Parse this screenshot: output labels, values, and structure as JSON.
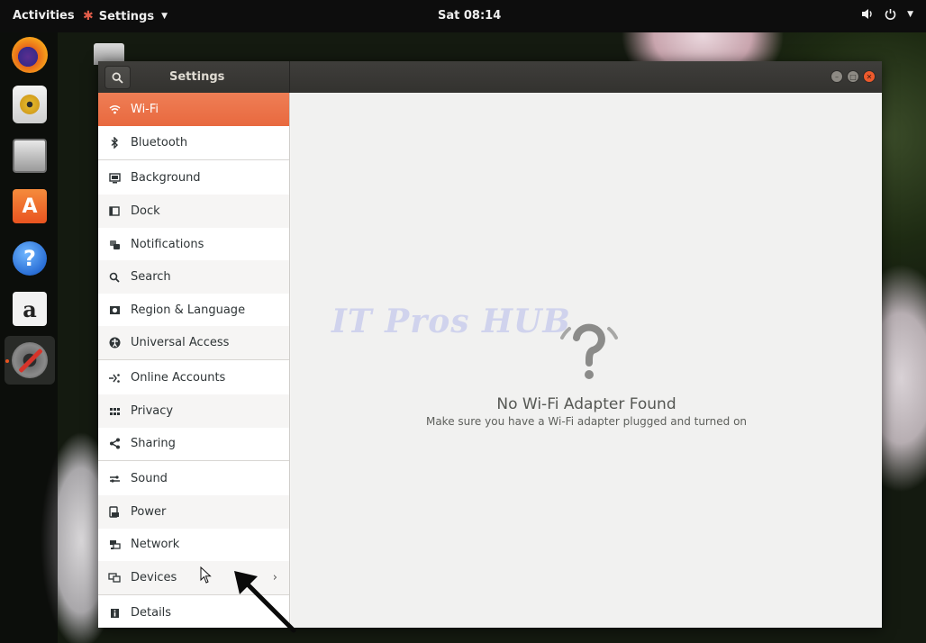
{
  "topbar": {
    "activities": "Activities",
    "app_menu": "Settings",
    "clock": "Sat 08:14"
  },
  "dock": {
    "items": [
      "firefox-icon",
      "rhythmbox-icon",
      "files-icon",
      "software-icon",
      "help-icon",
      "amazon-icon",
      "settings-icon"
    ]
  },
  "window": {
    "title": "Settings"
  },
  "sidebar": {
    "items": [
      {
        "label": "Wi-Fi",
        "icon": "wifi-icon",
        "selected": true
      },
      {
        "label": "Bluetooth",
        "icon": "bluetooth-icon"
      },
      {
        "label": "Background",
        "icon": "background-icon"
      },
      {
        "label": "Dock",
        "icon": "dock-icon"
      },
      {
        "label": "Notifications",
        "icon": "notifications-icon"
      },
      {
        "label": "Search",
        "icon": "search-icon"
      },
      {
        "label": "Region & Language",
        "icon": "region-icon"
      },
      {
        "label": "Universal Access",
        "icon": "universal-access-icon"
      },
      {
        "label": "Online Accounts",
        "icon": "online-accounts-icon"
      },
      {
        "label": "Privacy",
        "icon": "privacy-icon"
      },
      {
        "label": "Sharing",
        "icon": "sharing-icon"
      },
      {
        "label": "Sound",
        "icon": "sound-icon"
      },
      {
        "label": "Power",
        "icon": "power-icon"
      },
      {
        "label": "Network",
        "icon": "network-icon"
      },
      {
        "label": "Devices",
        "icon": "devices-icon",
        "has_submenu": true
      },
      {
        "label": "Details",
        "icon": "details-icon"
      }
    ]
  },
  "main": {
    "empty_title": "No Wi-Fi Adapter Found",
    "empty_subtitle": "Make sure you have a Wi-Fi adapter plugged and turned on"
  },
  "watermark": "IT Pros HUB",
  "colors": {
    "accent": "#e95420",
    "selected_row": "#e8693f",
    "topbar": "#0d0d0d",
    "titlebar": "#3a3936"
  }
}
